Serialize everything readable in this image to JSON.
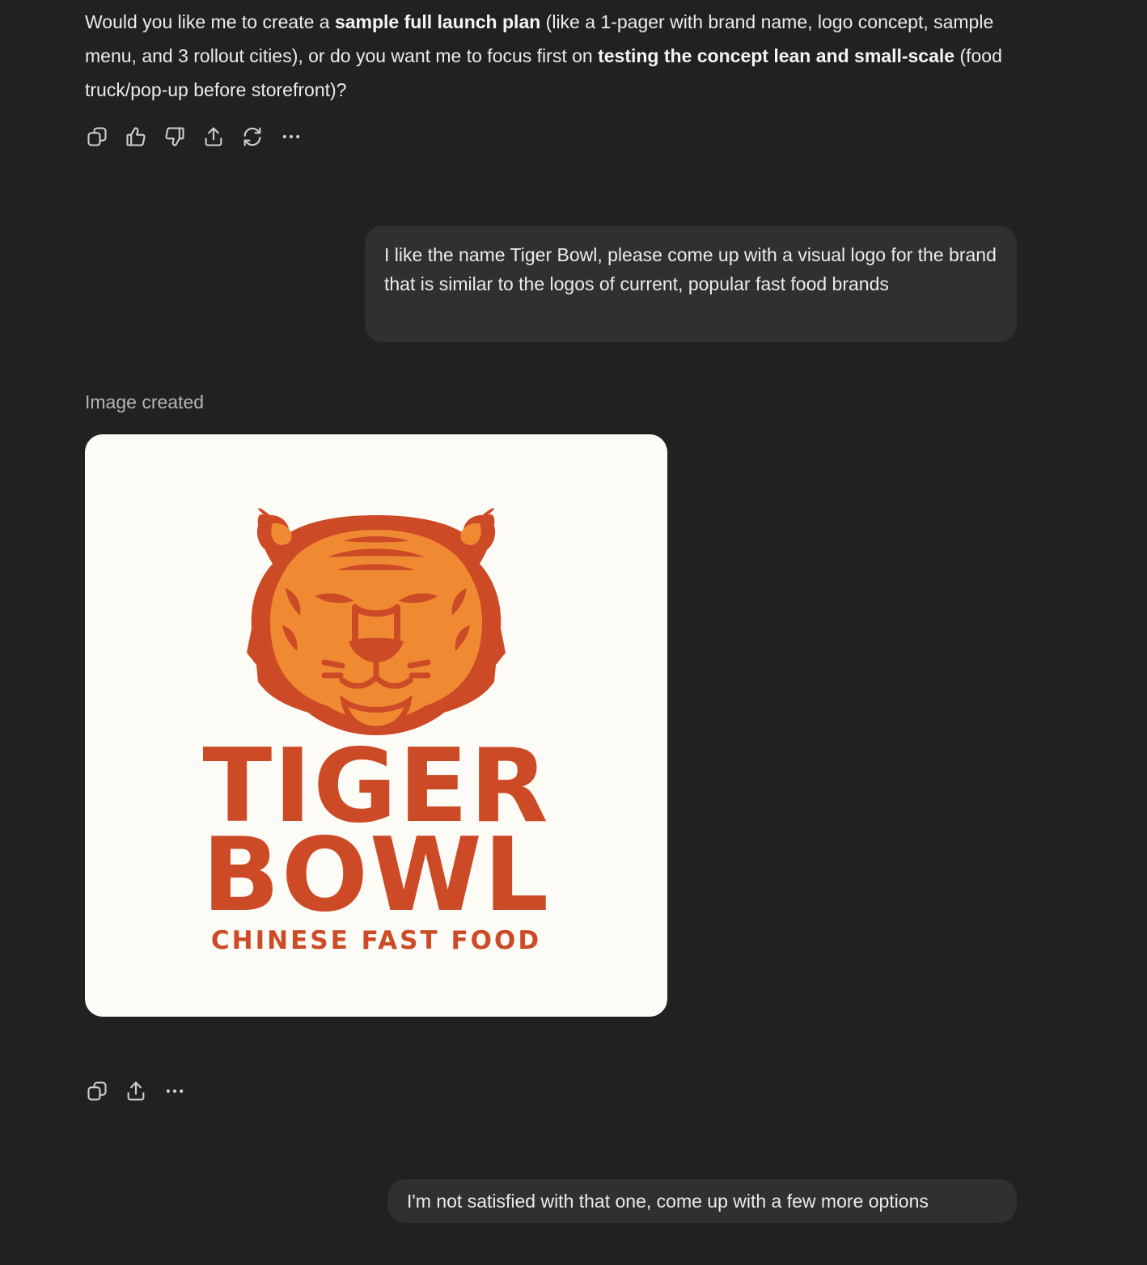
{
  "assistant_message": {
    "part1": "Would you like me to create a ",
    "bold1": "sample full launch plan",
    "part2": " (like a 1-pager with brand name, logo concept, sample menu, and 3 rollout cities), or do you want me to focus first on ",
    "bold2": "testing the concept lean and small-scale",
    "part3": " (food truck/pop-up before storefront)?"
  },
  "actions_first": [
    "copy-icon",
    "thumbs-up-icon",
    "thumbs-down-icon",
    "share-icon",
    "regenerate-icon",
    "more-icon"
  ],
  "user_message_1": "I like the name Tiger Bowl, please come up with a visual logo for the brand that is similar to the logos of current, popular fast food brands",
  "image_section": {
    "label": "Image created",
    "logo": {
      "word1": "TIGER",
      "word2": "BOWL",
      "tagline": "CHINESE FAST FOOD",
      "colors": {
        "primary": "#cd4a26",
        "fill": "#ef8a33",
        "background": "#fcfbf6"
      }
    }
  },
  "actions_second": [
    "copy-icon",
    "share-icon",
    "more-icon"
  ],
  "user_message_2": "I'm not satisfied with that one, come up with a few more options"
}
